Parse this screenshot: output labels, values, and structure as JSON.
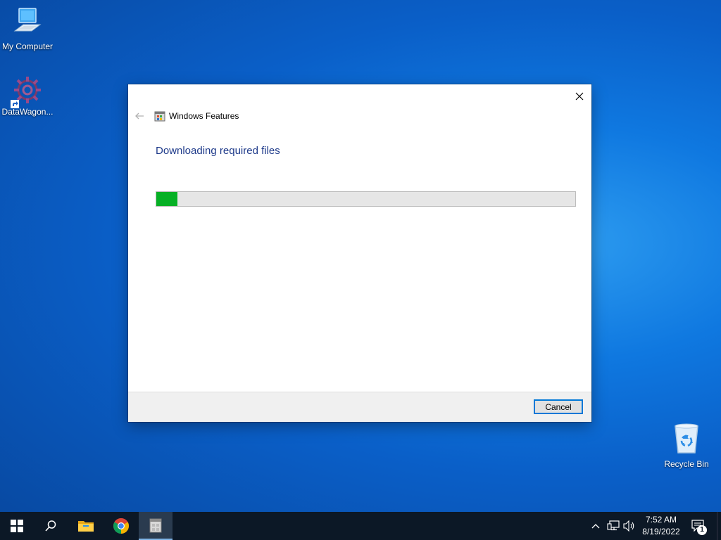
{
  "desktop": {
    "icons": [
      {
        "label": "My Computer",
        "icon": "computer-icon"
      },
      {
        "label": "DataWagon...",
        "icon": "datawagon-gear-icon"
      },
      {
        "label": "Recycle Bin",
        "icon": "recycle-bin-icon"
      }
    ]
  },
  "dialog": {
    "title": "Windows Features",
    "heading": "Downloading required files",
    "progress": 0.05,
    "cancel_label": "Cancel",
    "accent_color": "#06b025"
  },
  "taskbar": {
    "pinned": [
      {
        "name": "start-button",
        "icon": "windows-logo-icon"
      },
      {
        "name": "search-button",
        "icon": "search-icon"
      },
      {
        "name": "file-explorer",
        "icon": "folder-icon"
      },
      {
        "name": "chrome",
        "icon": "chrome-icon"
      },
      {
        "name": "windows-features",
        "icon": "windows-features-icon"
      }
    ],
    "clock": {
      "time": "7:52 AM",
      "date": "8/19/2022"
    },
    "notifications_count": "1"
  }
}
